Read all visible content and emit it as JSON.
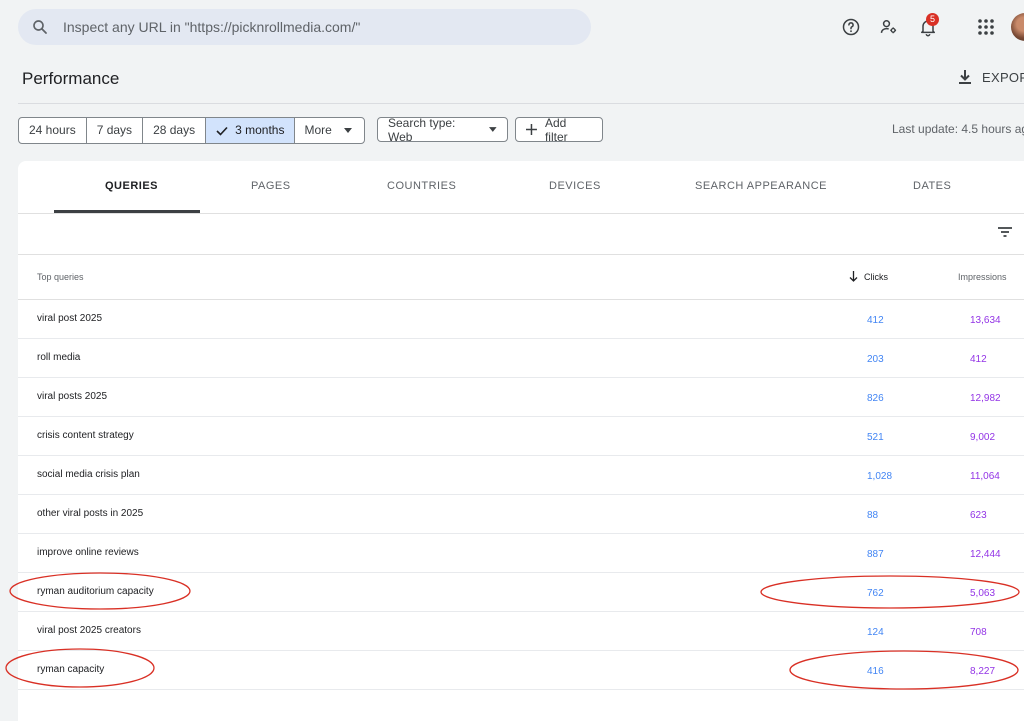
{
  "search": {
    "placeholder": "Inspect any URL in \"https://picknrollmedia.com/\""
  },
  "top_icons": [
    "help-icon",
    "manage-users-icon",
    "notifications-icon",
    "apps-grid-icon"
  ],
  "notifications": {
    "count": "5"
  },
  "page": {
    "title": "Performance",
    "export_label": "EXPORT"
  },
  "filters": {
    "date_ranges": [
      {
        "label": "24 hours",
        "selected": false
      },
      {
        "label": "7 days",
        "selected": false
      },
      {
        "label": "28 days",
        "selected": false
      },
      {
        "label": "3 months",
        "selected": true
      },
      {
        "label": "More",
        "selected": false
      }
    ],
    "search_type": "Search type: Web",
    "add_filter": "Add filter",
    "last_update": "Last update: 4.5 hours ag"
  },
  "tabs": [
    {
      "label": "QUERIES",
      "active": true
    },
    {
      "label": "PAGES",
      "active": false
    },
    {
      "label": "COUNTRIES",
      "active": false
    },
    {
      "label": "DEVICES",
      "active": false
    },
    {
      "label": "SEARCH APPEARANCE",
      "active": false
    },
    {
      "label": "DATES",
      "active": false
    }
  ],
  "table": {
    "headers": {
      "query": "Top queries",
      "clicks": "Clicks",
      "impressions": "Impressions"
    },
    "sorted_by": "Clicks",
    "rows": [
      {
        "query": "viral post 2025",
        "clicks": "412",
        "impressions": "13,634"
      },
      {
        "query": "roll media",
        "clicks": "203",
        "impressions": "412"
      },
      {
        "query": "viral posts 2025",
        "clicks": "826",
        "impressions": "12,982"
      },
      {
        "query": "crisis content strategy",
        "clicks": "521",
        "impressions": "9,002"
      },
      {
        "query": "social media crisis plan",
        "clicks": "1,028",
        "impressions": "11,064"
      },
      {
        "query": "other viral posts in 2025",
        "clicks": "88",
        "impressions": "623"
      },
      {
        "query": "improve online reviews",
        "clicks": "887",
        "impressions": "12,444"
      },
      {
        "query": "ryman auditorium capacity",
        "clicks": "762",
        "impressions": "5,063"
      },
      {
        "query": "viral post 2025 creators",
        "clicks": "124",
        "impressions": "708"
      },
      {
        "query": "ryman capacity",
        "clicks": "416",
        "impressions": "8,227"
      }
    ]
  },
  "colors": {
    "clicks": "#4285f4",
    "impressions": "#9334e6",
    "selected_range": "#d2e3fc",
    "annotation": "#d93025",
    "badge": "#d93025"
  }
}
